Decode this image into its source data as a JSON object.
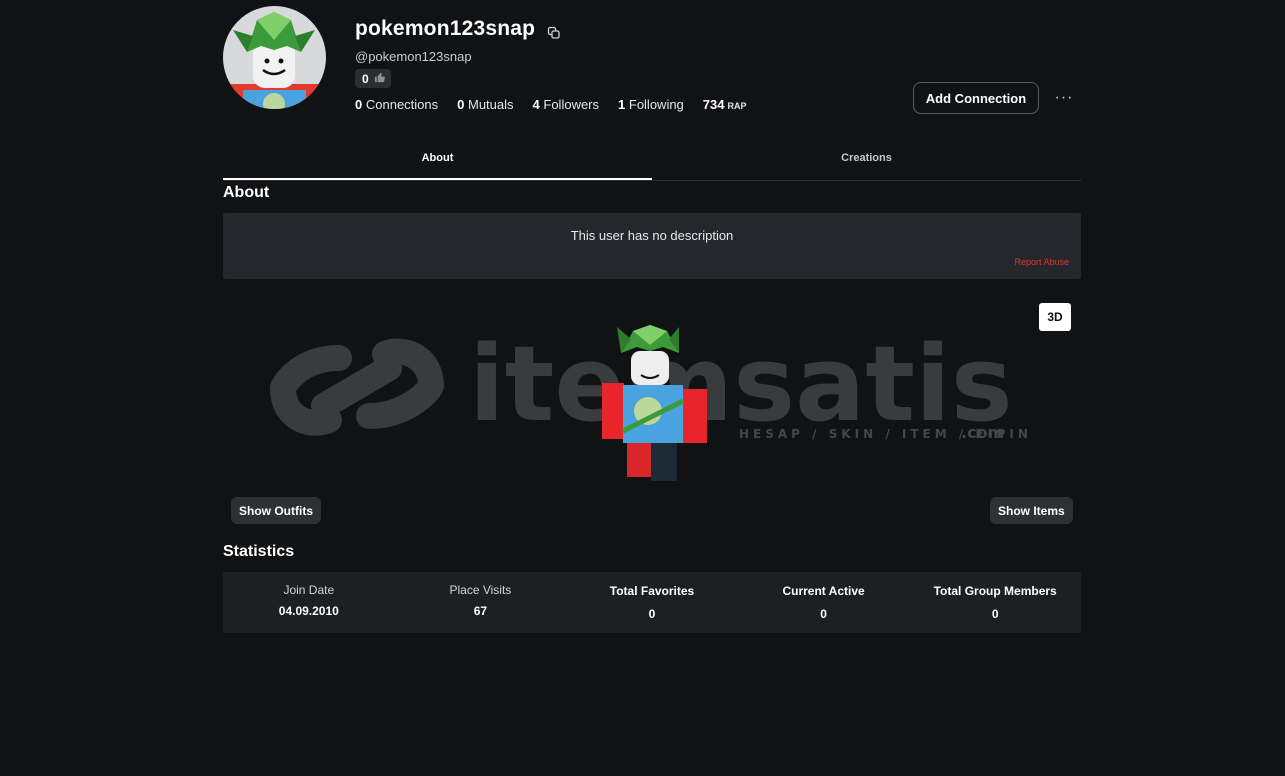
{
  "profile": {
    "username": "pokemon123snap",
    "handle": "@pokemon123snap",
    "vote_count": "0",
    "connections_count": "0",
    "connections_label": "Connections",
    "mutuals_count": "0",
    "mutuals_label": "Mutuals",
    "followers_count": "4",
    "followers_label": "Followers",
    "following_count": "1",
    "following_label": "Following",
    "rap_value": "734",
    "rap_label": "RAP",
    "add_connection_label": "Add Connection",
    "more_label": "···"
  },
  "tabs": [
    {
      "label": "About",
      "active": true
    },
    {
      "label": "Creations",
      "active": false
    }
  ],
  "about": {
    "title": "About",
    "description": "This user has no description",
    "report_label": "Report Abuse"
  },
  "viewer": {
    "toggle_label": "3D",
    "show_outfits_label": "Show Outfits",
    "show_items_label": "Show Items"
  },
  "watermark": {
    "brand": "itemsatis",
    "tagline": "HESAP / SKIN / ITEM / E-PIN",
    "suffix": ".com"
  },
  "statistics": {
    "title": "Statistics",
    "items": [
      {
        "label": "Join Date",
        "value": "04.09.2010"
      },
      {
        "label": "Place Visits",
        "value": "67"
      },
      {
        "label": "Total Favorites",
        "value": "0"
      },
      {
        "label": "Current Active",
        "value": "0"
      },
      {
        "label": "Total Group Members",
        "value": "0"
      }
    ]
  },
  "colors": {
    "background": "#111214",
    "panel": "#25272d",
    "report_red": "#e0332f"
  }
}
